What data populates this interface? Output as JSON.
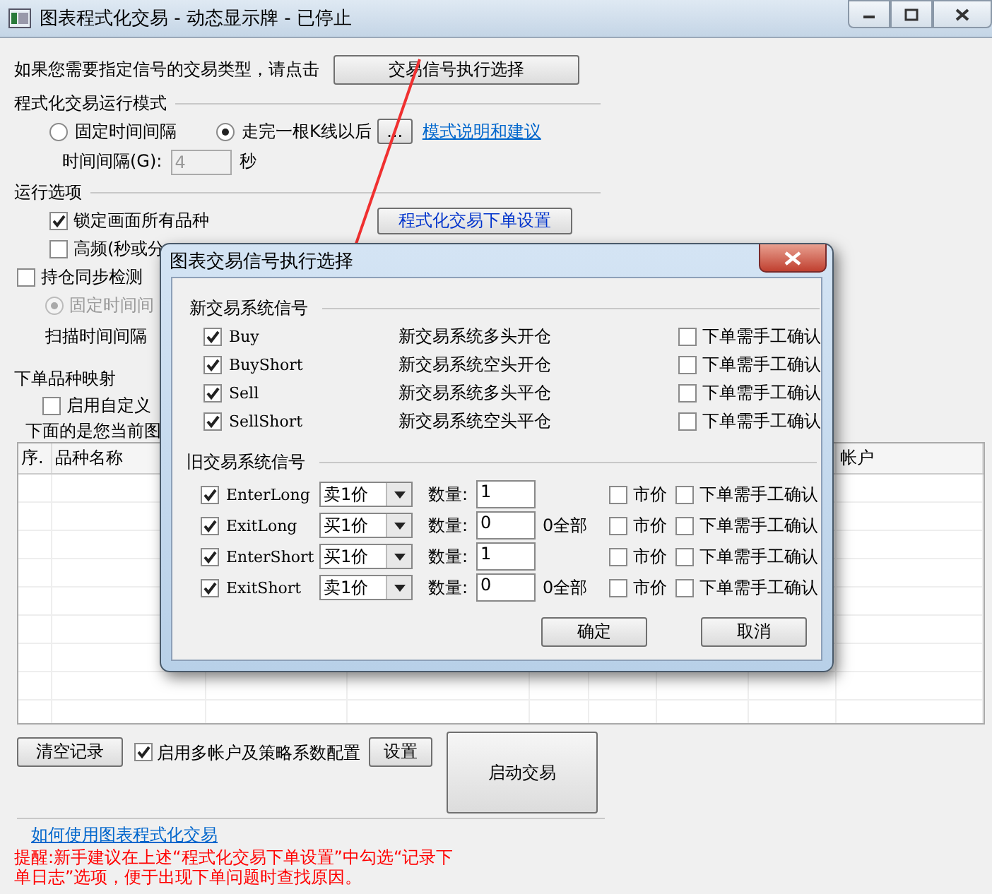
{
  "window": {
    "title": "图表程式化交易 - 动态显示牌 - 已停止"
  },
  "signal_prompt": {
    "text": "如果您需要指定信号的交易类型，请点击",
    "button": "交易信号执行选择"
  },
  "run_mode": {
    "heading": "程式化交易运行模式",
    "options": [
      {
        "label": "固定时间间隔",
        "selected": false
      },
      {
        "label": "走完一根K线以后",
        "selected": true
      }
    ],
    "more_button": "...",
    "help_link": "模式说明和建议",
    "interval_label": "时间间隔(G):",
    "interval": {
      "value": "4",
      "disabled": true
    },
    "interval_unit": "秒"
  },
  "run_options": {
    "heading": "运行选项",
    "lock": {
      "label": "锁定画面所有品种",
      "checked": true
    },
    "order_settings_button": "程式化交易下单设置",
    "high_freq": {
      "label": "高频(秒或分",
      "checked": false
    }
  },
  "position_sync": {
    "label": "持仓同步检测",
    "checked": false,
    "mode": {
      "label": "固定时间间",
      "selected": true,
      "disabled": true
    },
    "scan_label": "扫描时间间隔"
  },
  "mapping": {
    "heading": "下单品种映射",
    "custom": {
      "label": "启用自定义",
      "checked": false
    },
    "note": "下面的是您当前图"
  },
  "table": {
    "columns": [
      "序.",
      "品种名称",
      "帐户"
    ]
  },
  "bottom": {
    "clear_button": "清空记录",
    "multi_account": {
      "label": "启用多帐户及策略系数配置",
      "checked": true
    },
    "settings_button": "设置",
    "start_button": "启动交易",
    "help_link": "如何使用图表程式化交易",
    "warning": "提醒:新手建议在上述“程式化交易下单设置”中勾选“记录下单日志”选项，便于出现下单问题时查找原因。"
  },
  "dialog": {
    "title": "图表交易信号执行选择",
    "new_group": {
      "heading": "新交易系统信号",
      "signals": [
        {
          "name": "Buy",
          "checked": true,
          "description": "新交易系统多头开仓",
          "manual": {
            "label": "下单需手工确认",
            "checked": false
          }
        },
        {
          "name": "BuyShort",
          "checked": true,
          "description": "新交易系统空头开仓",
          "manual": {
            "label": "下单需手工确认",
            "checked": false
          }
        },
        {
          "name": "Sell",
          "checked": true,
          "description": "新交易系统多头平仓",
          "manual": {
            "label": "下单需手工确认",
            "checked": false
          }
        },
        {
          "name": "SellShort",
          "checked": true,
          "description": "新交易系统空头平仓",
          "manual": {
            "label": "下单需手工确认",
            "checked": false
          }
        }
      ]
    },
    "old_group": {
      "heading": "旧交易系统信号",
      "signals": [
        {
          "name": "EnterLong",
          "checked": true,
          "price": "卖1价",
          "qty_label": "数量:",
          "qty": "1",
          "market": {
            "label": "市价",
            "checked": false
          },
          "manual": {
            "label": "下单需手工确认",
            "checked": false
          }
        },
        {
          "name": "ExitLong",
          "checked": true,
          "price": "买1价",
          "qty_label": "数量:",
          "qty": "0",
          "all_label": "0全部",
          "market": {
            "label": "市价",
            "checked": false
          },
          "manual": {
            "label": "下单需手工确认",
            "checked": false
          }
        },
        {
          "name": "EnterShort",
          "checked": true,
          "price": "买1价",
          "qty_label": "数量:",
          "qty": "1",
          "market": {
            "label": "市价",
            "checked": false
          },
          "manual": {
            "label": "下单需手工确认",
            "checked": false
          }
        },
        {
          "name": "ExitShort",
          "checked": true,
          "price": "卖1价",
          "qty_label": "数量:",
          "qty": "0",
          "all_label": "0全部",
          "market": {
            "label": "市价",
            "checked": false
          },
          "manual": {
            "label": "下单需手工确认",
            "checked": false
          }
        }
      ]
    },
    "ok_button": "确定",
    "cancel_button": "取消"
  }
}
